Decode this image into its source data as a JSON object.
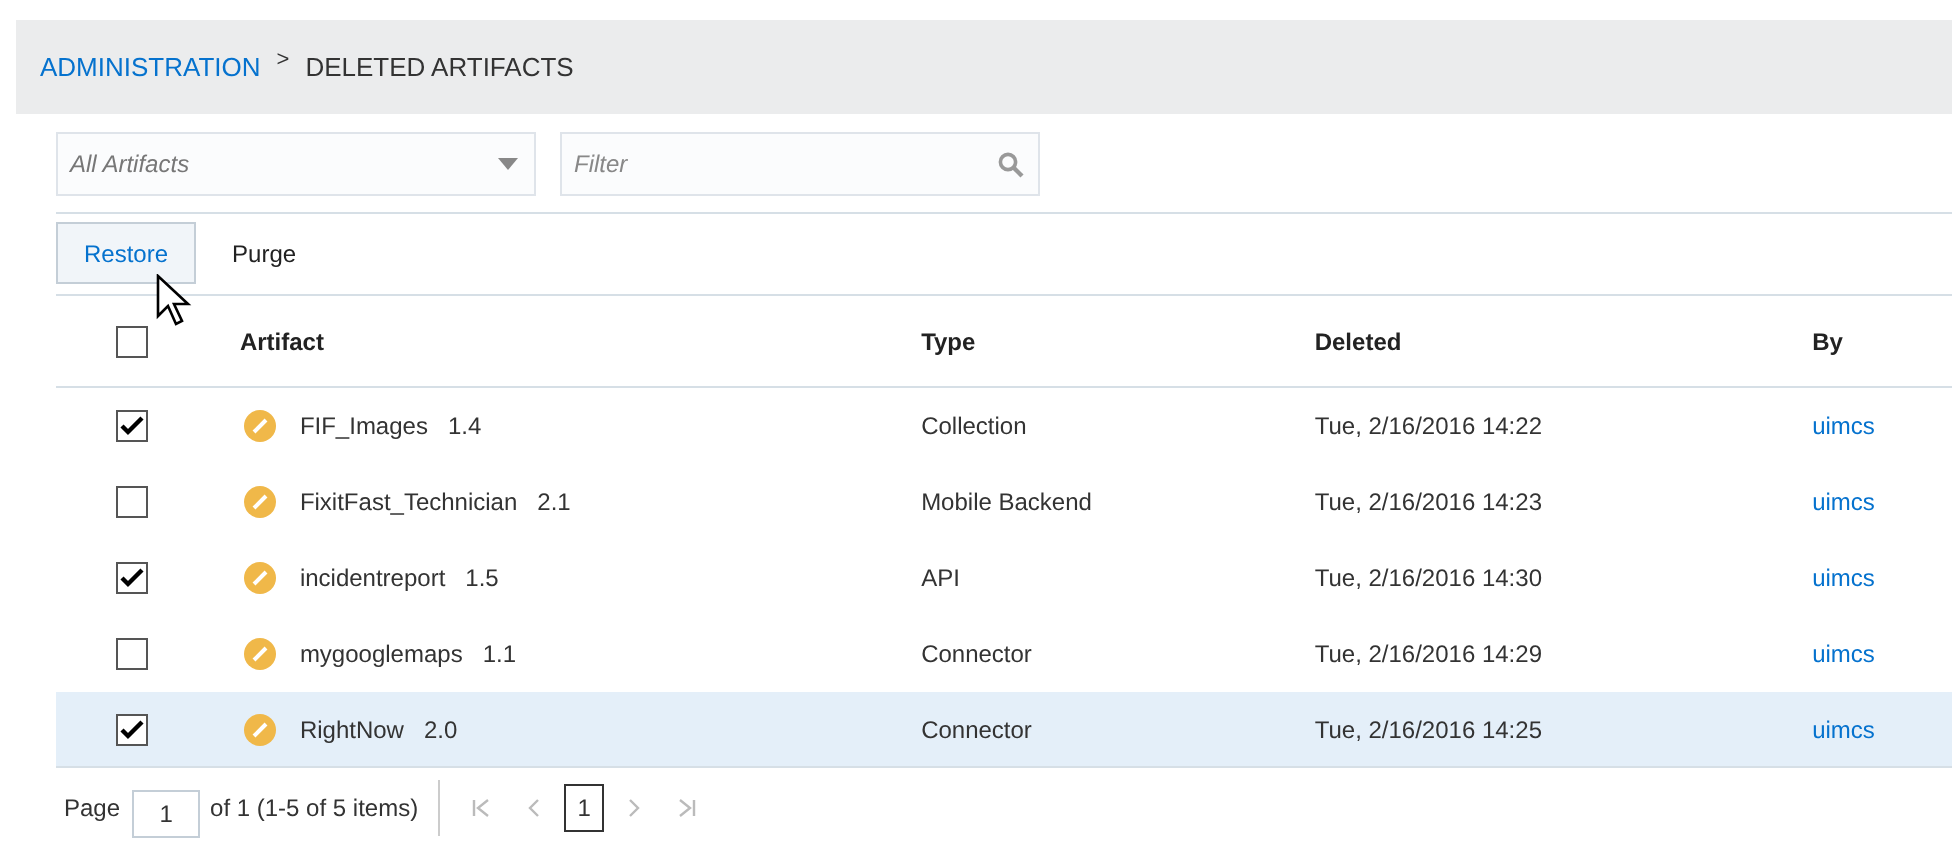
{
  "breadcrumb": {
    "items": [
      "ADMINISTRATION",
      "DELETED ARTIFACTS"
    ],
    "separator": ">"
  },
  "artifact_dropdown": {
    "value": "All Artifacts"
  },
  "filter": {
    "placeholder": "Filter"
  },
  "toolbar": {
    "buttons": [
      {
        "label": "Restore",
        "hovered": true
      },
      {
        "label": "Purge",
        "hovered": false
      }
    ]
  },
  "table": {
    "select_all": {
      "checked": false
    },
    "columns": [
      "Artifact",
      "Type",
      "Deleted",
      "By"
    ],
    "rows": [
      {
        "checked": true,
        "selected": false,
        "name": "FIF_Images",
        "version": "1.4",
        "type": "Collection",
        "deleted": "Tue, 2/16/2016 14:22",
        "by": "uimcs"
      },
      {
        "checked": false,
        "selected": false,
        "name": "FixitFast_Technician",
        "version": "2.1",
        "type": "Mobile Backend",
        "deleted": "Tue, 2/16/2016 14:23",
        "by": "uimcs"
      },
      {
        "checked": true,
        "selected": false,
        "name": "incidentreport",
        "version": "1.5",
        "type": "API",
        "deleted": "Tue, 2/16/2016 14:30",
        "by": "uimcs"
      },
      {
        "checked": false,
        "selected": false,
        "name": "mygooglemaps",
        "version": "1.1",
        "type": "Connector",
        "deleted": "Tue, 2/16/2016 14:29",
        "by": "uimcs"
      },
      {
        "checked": true,
        "selected": true,
        "name": "RightNow",
        "version": "2.0",
        "type": "Connector",
        "deleted": "Tue, 2/16/2016 14:25",
        "by": "uimcs"
      }
    ]
  },
  "pagination": {
    "label": "Page",
    "page_value": "1",
    "summary": "of 1 (1-5 of 5 items)",
    "pages": [
      {
        "label": "1",
        "selected": true
      }
    ]
  }
}
